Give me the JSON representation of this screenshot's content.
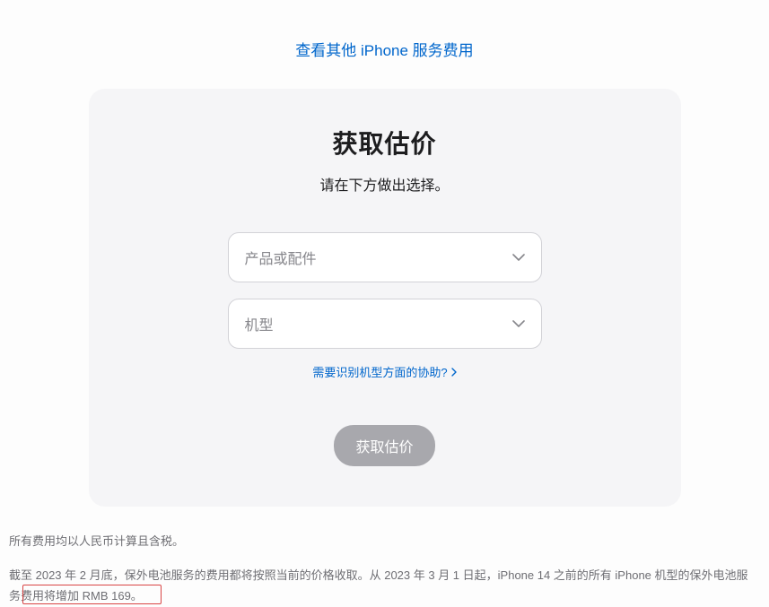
{
  "top_link": "查看其他 iPhone 服务费用",
  "card": {
    "title": "获取估价",
    "subtitle": "请在下方做出选择。",
    "select_product_placeholder": "产品或配件",
    "select_model_placeholder": "机型",
    "help_link": "需要识别机型方面的协助?",
    "button": "获取估价"
  },
  "footer": {
    "line1": "所有费用均以人民币计算且含税。",
    "line2": "截至 2023 年 2 月底，保外电池服务的费用都将按照当前的价格收取。从 2023 年 3 月 1 日起，iPhone 14 之前的所有 iPhone 机型的保外电池服务费用将增加 RMB 169。"
  }
}
